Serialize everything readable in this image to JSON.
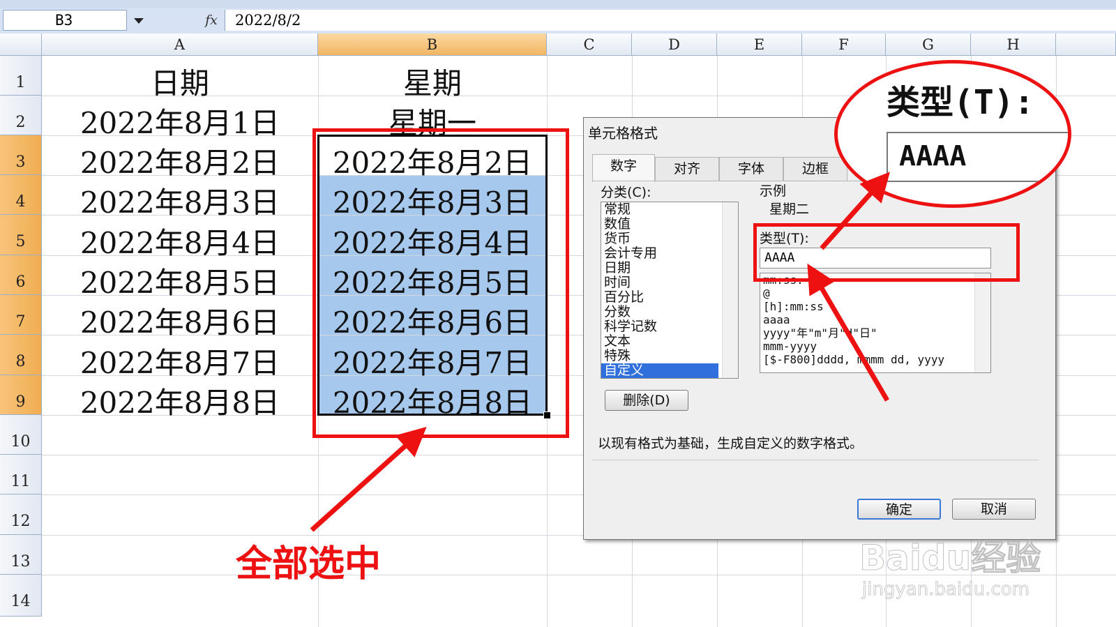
{
  "formula_bar": {
    "cell_ref": "B3",
    "fx_label": "fx",
    "formula": "2022/8/2"
  },
  "columns": [
    "A",
    "B",
    "C",
    "D",
    "E",
    "F",
    "G",
    "H"
  ],
  "rows": [
    "1",
    "2",
    "3",
    "4",
    "5",
    "6",
    "7",
    "8",
    "9",
    "10",
    "11",
    "12",
    "13",
    "14"
  ],
  "sheet": {
    "col_a": [
      "日期",
      "2022年8月1日",
      "2022年8月2日",
      "2022年8月3日",
      "2022年8月4日",
      "2022年8月5日",
      "2022年8月6日",
      "2022年8月7日",
      "2022年8月8日"
    ],
    "col_b": [
      "星期",
      "星期一",
      "2022年8月2日",
      "2022年8月3日",
      "2022年8月4日",
      "2022年8月5日",
      "2022年8月6日",
      "2022年8月7日",
      "2022年8月8日"
    ]
  },
  "annotation": {
    "label": "全部选中"
  },
  "dialog": {
    "title": "单元格格式",
    "tabs": [
      "数字",
      "对齐",
      "字体",
      "边框"
    ],
    "category_label": "分类(C):",
    "categories": [
      "常规",
      "数值",
      "货币",
      "会计专用",
      "日期",
      "时间",
      "百分比",
      "分数",
      "科学记数",
      "文本",
      "特殊",
      "自定义"
    ],
    "sample_label": "示例",
    "sample_value": "星期二",
    "type_label": "类型(T):",
    "type_value": "AAAA",
    "formats": [
      "mm:ss.",
      "@",
      "[h]:mm:ss",
      "aaaa",
      "yyyy\"年\"m\"月\"d\"日\"",
      "mmm-yyyy",
      "[$-F800]dddd, mmmm dd, yyyy"
    ],
    "delete_button": "删除(D)",
    "description": "以现有格式为基础，生成自定义的数字格式。",
    "ok_button": "确定",
    "cancel_button": "取消"
  },
  "zoom_inset": {
    "label": "类型(T):",
    "value": "AAAA"
  },
  "watermark": {
    "brand": "Baidu经验",
    "url": "jingyan.baidu.com"
  },
  "colors": {
    "accent_red": "#e11111",
    "selection_blue": "#a6c8ec",
    "header_highlight": "#f3b662",
    "list_selection": "#3070dd"
  }
}
